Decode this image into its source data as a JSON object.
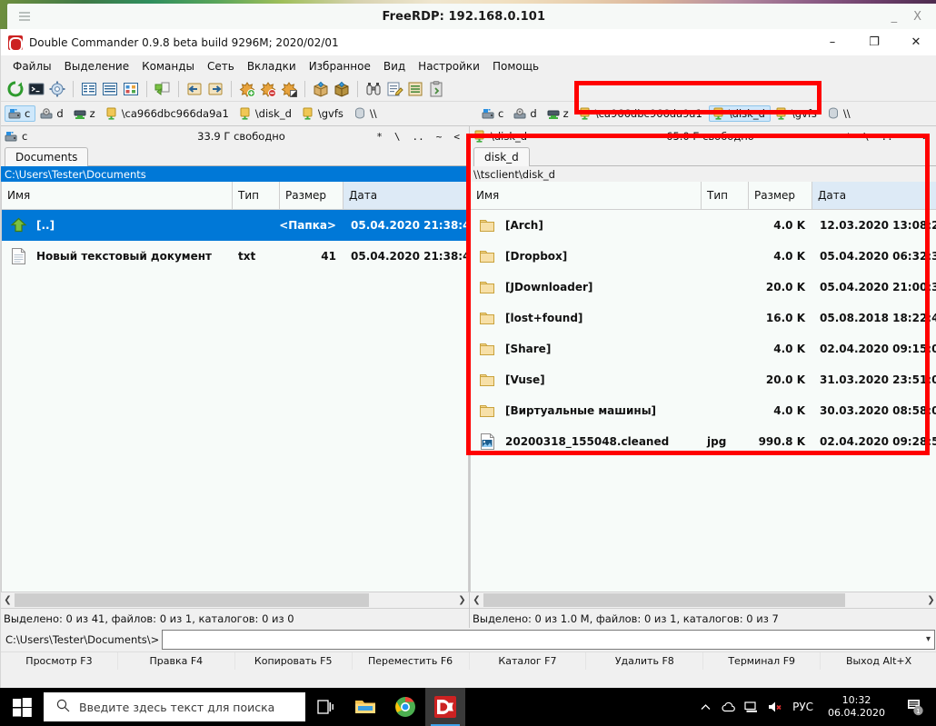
{
  "rdp": {
    "title": "FreeRDP: 192.168.0.101",
    "menu_icon": "hamburger-icon",
    "minimize": "_",
    "close": "X"
  },
  "dc_window": {
    "title": "Double Commander 0.9.8 beta build 9296M; 2020/02/01",
    "minimize": "–",
    "restore": "❐",
    "close": "✕"
  },
  "menu": {
    "items": [
      {
        "label": "Файлы",
        "name": "menu-files"
      },
      {
        "label": "Выделение",
        "name": "menu-selection"
      },
      {
        "label": "Команды",
        "name": "menu-commands"
      },
      {
        "label": "Сеть",
        "name": "menu-network"
      },
      {
        "label": "Вкладки",
        "name": "menu-tabs"
      },
      {
        "label": "Избранное",
        "name": "menu-favorites"
      },
      {
        "label": "Вид",
        "name": "menu-view"
      },
      {
        "label": "Настройки",
        "name": "menu-settings"
      },
      {
        "label": "Помощь",
        "name": "menu-help"
      }
    ]
  },
  "toolbar": {
    "buttons": [
      "refresh-icon",
      "terminal-icon",
      "settings-gear-icon",
      "brief-view-icon",
      "full-view-icon",
      "thumbnails-icon",
      "copy-path-icon",
      "open-left-icon",
      "open-right-icon",
      "mark-add-icon",
      "mark-remove-icon",
      "mark-invert-icon",
      "pack-icon",
      "unpack-icon",
      "search-binoculars-icon",
      "multirename-icon",
      "list-icon",
      "clipboard-icon"
    ]
  },
  "drives": {
    "left": [
      {
        "label": "c",
        "icon": "hdd-icon",
        "selected": true
      },
      {
        "label": "d",
        "icon": "cd-icon",
        "selected": false
      },
      {
        "label": "z",
        "icon": "network-drive-icon",
        "selected": false
      },
      {
        "label": "\\ca966dbc966da9a1",
        "icon": "network-share-icon",
        "selected": false
      },
      {
        "label": "\\disk_d",
        "icon": "network-share-icon",
        "selected": false
      },
      {
        "label": "\\gvfs",
        "icon": "network-share-icon",
        "selected": false
      },
      {
        "label": "\\\\",
        "icon": "network-neighborhood-icon",
        "selected": false
      }
    ],
    "right": [
      {
        "label": "c",
        "icon": "hdd-icon",
        "selected": false
      },
      {
        "label": "d",
        "icon": "cd-icon",
        "selected": false
      },
      {
        "label": "z",
        "icon": "network-drive-icon",
        "selected": false
      },
      {
        "label": "\\ca966dbc966da9a1",
        "icon": "network-share-icon",
        "selected": false
      },
      {
        "label": "\\disk_d",
        "icon": "network-share-icon",
        "selected": true
      },
      {
        "label": "\\gvfs",
        "icon": "network-share-icon",
        "selected": false
      },
      {
        "label": "\\\\",
        "icon": "network-neighborhood-icon",
        "selected": false
      }
    ]
  },
  "left_pane": {
    "drive_label": "c",
    "drive_icon": "hdd-icon",
    "free_space": "33.9 Г свободно",
    "hotkeys": [
      "*",
      "\\",
      "..",
      "~",
      "<"
    ],
    "tab": "Documents",
    "path": "C:\\Users\\Tester\\Documents",
    "columns": [
      "Имя",
      "Тип",
      "Размер",
      "Дата"
    ],
    "rows": [
      {
        "icon": "up-folder-icon",
        "name": "[..]",
        "type": "",
        "size": "<Папка>",
        "date": "05.04.2020 21:38:4",
        "selected": true
      },
      {
        "icon": "text-file-icon",
        "name": "Новый текстовый документ",
        "type": "txt",
        "size": "41",
        "date": "05.04.2020 21:38:4",
        "selected": false
      }
    ],
    "status": "Выделено: 0 из 41, файлов: 0 из 1, каталогов: 0 из 0"
  },
  "right_pane": {
    "drive_label": "\\disk_d",
    "drive_icon": "network-share-icon",
    "free_space": "65.0 Г свободно",
    "hotkeys": [
      "*",
      "\\",
      "..",
      "~",
      ">"
    ],
    "tab": "disk_d",
    "path": "\\\\tsclient\\disk_d",
    "columns": [
      "Имя",
      "Тип",
      "Размер",
      "Дата"
    ],
    "rows": [
      {
        "icon": "folder-icon",
        "name": "[Arch]",
        "type": "",
        "size": "4.0 K",
        "date": "12.03.2020 13:08:2",
        "selected": false
      },
      {
        "icon": "folder-icon",
        "name": "[Dropbox]",
        "type": "",
        "size": "4.0 K",
        "date": "05.04.2020 06:32:3",
        "selected": false
      },
      {
        "icon": "folder-icon",
        "name": "[JDownloader]",
        "type": "",
        "size": "20.0 K",
        "date": "05.04.2020 21:00:3",
        "selected": false
      },
      {
        "icon": "folder-icon",
        "name": "[lost+found]",
        "type": "",
        "size": "16.0 K",
        "date": "05.08.2018 18:22:4",
        "selected": false
      },
      {
        "icon": "folder-icon",
        "name": "[Share]",
        "type": "",
        "size": "4.0 K",
        "date": "02.04.2020 09:15:0",
        "selected": false
      },
      {
        "icon": "folder-icon",
        "name": "[Vuse]",
        "type": "",
        "size": "20.0 K",
        "date": "31.03.2020 23:51:0",
        "selected": false
      },
      {
        "icon": "folder-icon",
        "name": "[Виртуальные машины]",
        "type": "",
        "size": "4.0 K",
        "date": "30.03.2020 08:58:0",
        "selected": false
      },
      {
        "icon": "image-file-icon",
        "name": "20200318_155048.cleaned",
        "type": "jpg",
        "size": "990.8 K",
        "date": "02.04.2020 09:28:5",
        "selected": false
      }
    ],
    "status": "Выделено: 0 из 1.0 M, файлов: 0 из 1, каталогов: 0 из 7"
  },
  "command_line": {
    "prompt": "C:\\Users\\Tester\\Documents\\>",
    "value": "",
    "dropdown_icon": "chevron-down-icon"
  },
  "function_keys": [
    "Просмотр F3",
    "Правка F4",
    "Копировать F5",
    "Переместить F6",
    "Каталог F7",
    "Удалить F8",
    "Терминал F9",
    "Выход Alt+X"
  ],
  "taskbar": {
    "start_icon": "windows-start-icon",
    "search_icon": "search-icon",
    "search_placeholder": "Введите здесь текст для поиска",
    "taskview_icon": "task-view-icon",
    "apps": [
      {
        "name": "file-explorer-icon",
        "active": false
      },
      {
        "name": "chrome-icon",
        "active": false
      },
      {
        "name": "double-commander-icon",
        "active": true
      }
    ],
    "tray": [
      "chevron-up-icon",
      "onedrive-icon",
      "network-icon",
      "volume-muted-icon"
    ],
    "language": "РУС",
    "time": "10:32",
    "date": "06.04.2020",
    "notification_icon": "action-center-icon",
    "notification_count": "1"
  },
  "annotations": {
    "accent_color": "#ff0000",
    "boxes": [
      {
        "name": "drives-bar-highlight"
      },
      {
        "name": "right-panel-highlight"
      }
    ]
  }
}
